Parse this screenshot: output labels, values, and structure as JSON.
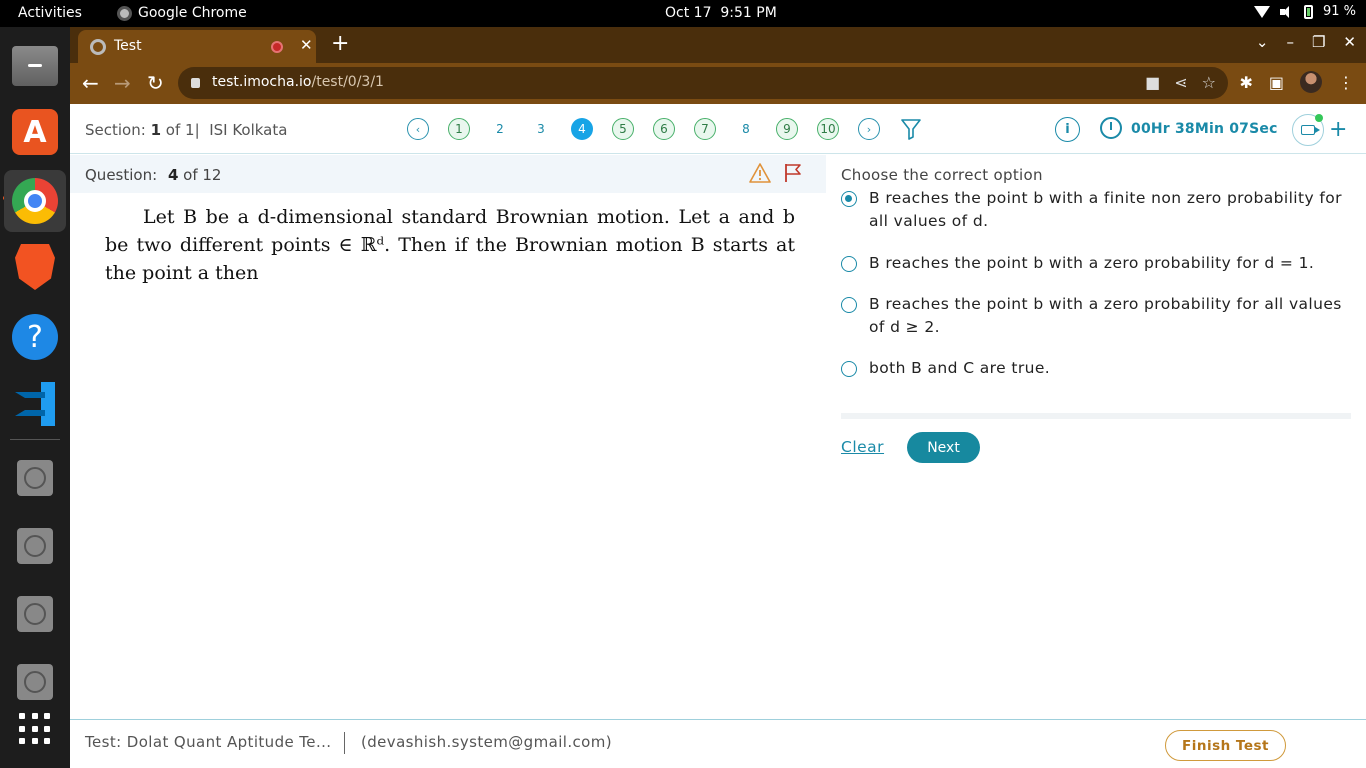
{
  "system_bar": {
    "activities": "Activities",
    "app_name": "Google Chrome",
    "date": "Oct 17",
    "time": "9:51 PM",
    "battery": "91 %"
  },
  "dock": {
    "items": [
      "files-icon",
      "app-center-icon",
      "chrome-icon",
      "brave-icon",
      "help-icon",
      "vscode-icon",
      "disk-icon",
      "disk-icon",
      "disk-icon",
      "disk-icon",
      "show-apps-icon"
    ]
  },
  "browser": {
    "tab_title": "Test",
    "url_host": "test.imocha.io",
    "url_path": "/test/0/3/1"
  },
  "header": {
    "section_label": "Section:",
    "section_current": "1",
    "section_of": "of 1",
    "section_sep": "|",
    "section_name": "ISI Kolkata",
    "questions": [
      {
        "label": "1",
        "status": "answered"
      },
      {
        "label": "2",
        "status": "unvisited"
      },
      {
        "label": "3",
        "status": "unvisited"
      },
      {
        "label": "4",
        "status": "current"
      },
      {
        "label": "5",
        "status": "answered"
      },
      {
        "label": "6",
        "status": "answered"
      },
      {
        "label": "7",
        "status": "answered"
      },
      {
        "label": "8",
        "status": "unvisited"
      },
      {
        "label": "9",
        "status": "answered"
      },
      {
        "label": "10",
        "status": "answered"
      }
    ],
    "info_label": "i",
    "timer": "00Hr 38Min 07Sec"
  },
  "question": {
    "label": "Question:",
    "number": "4",
    "of_total": "of 12",
    "text": "Let B be a d-dimensional standard Brownian motion. Let a and b be two different points ∈ ℝᵈ. Then if the Brownian motion B starts at the point a then"
  },
  "options": {
    "title": "Choose the correct option",
    "items": [
      {
        "text": " B reaches the point b with a finite non zero probability for all values of d.",
        "checked": true
      },
      {
        "text": "B reaches the point b with a zero probability for d = 1.",
        "checked": false
      },
      {
        "text": "B reaches the point b with a zero probability for all values of d ≥ 2.",
        "checked": false
      },
      {
        "text": "both B and C are true.",
        "checked": false
      }
    ],
    "clear_label": "Clear",
    "next_label": "Next"
  },
  "footer": {
    "test_name": "Test: Dolat Quant Aptitude Te...",
    "email": "(devashish.system@gmail.com)",
    "finish_label": "Finish Test"
  },
  "colors": {
    "accent": "#1a8aa8",
    "current_question": "#18a4e6",
    "answered": "#48b06a",
    "finish": "#d09a3c",
    "browser_frame": "#7a4b12"
  }
}
